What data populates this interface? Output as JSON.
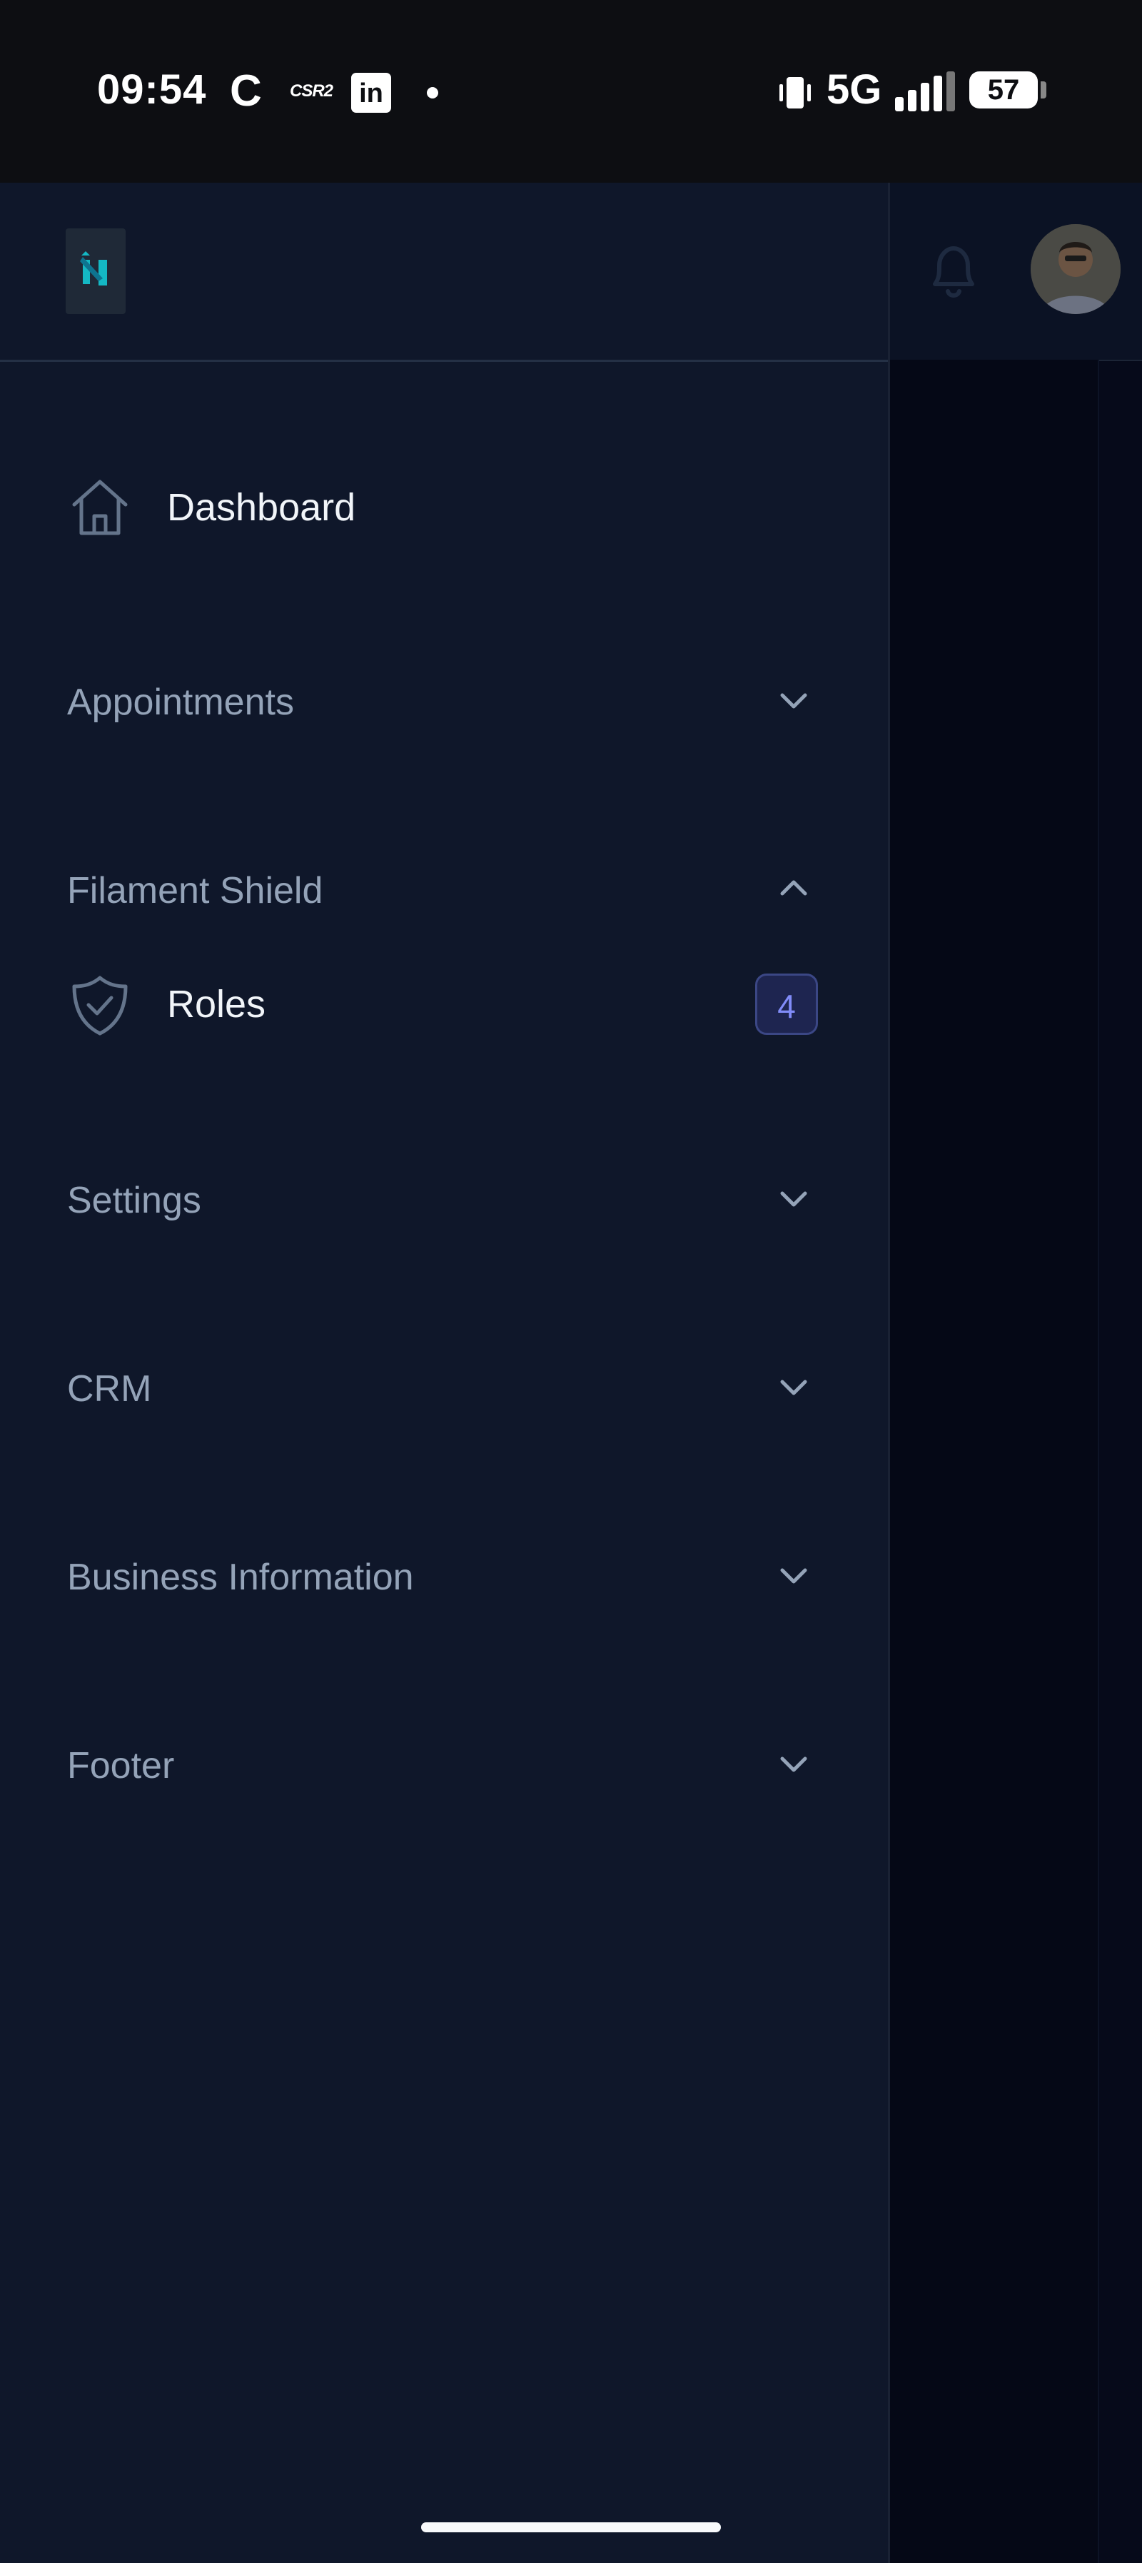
{
  "status_bar": {
    "time": "09:54",
    "carrier_icon_label": "C",
    "app_label": "CSR2",
    "linkedin_label": "in",
    "network": "5G",
    "battery_percent": "57",
    "signal_bars": 4
  },
  "header": {
    "logo_icon": "filament-logo-icon",
    "notifications_icon": "bell-icon",
    "avatar_icon": "user-avatar"
  },
  "nav": {
    "dashboard": {
      "label": "Dashboard",
      "icon": "home-icon"
    },
    "groups": [
      {
        "label": "Appointments",
        "expanded": false
      },
      {
        "label": "Filament Shield",
        "expanded": true
      },
      {
        "label": "Settings",
        "expanded": false
      },
      {
        "label": "CRM",
        "expanded": false
      },
      {
        "label": "Business Information",
        "expanded": false
      },
      {
        "label": "Footer",
        "expanded": false
      }
    ],
    "roles": {
      "label": "Roles",
      "icon": "shield-check-icon",
      "badge": "4"
    }
  },
  "colors": {
    "drawer_bg": "#0f172a",
    "label_active": "#f1f5f9",
    "group_label": "#94a3b8",
    "badge_text": "#818cf8",
    "logo_accent": "#14b8c4"
  }
}
